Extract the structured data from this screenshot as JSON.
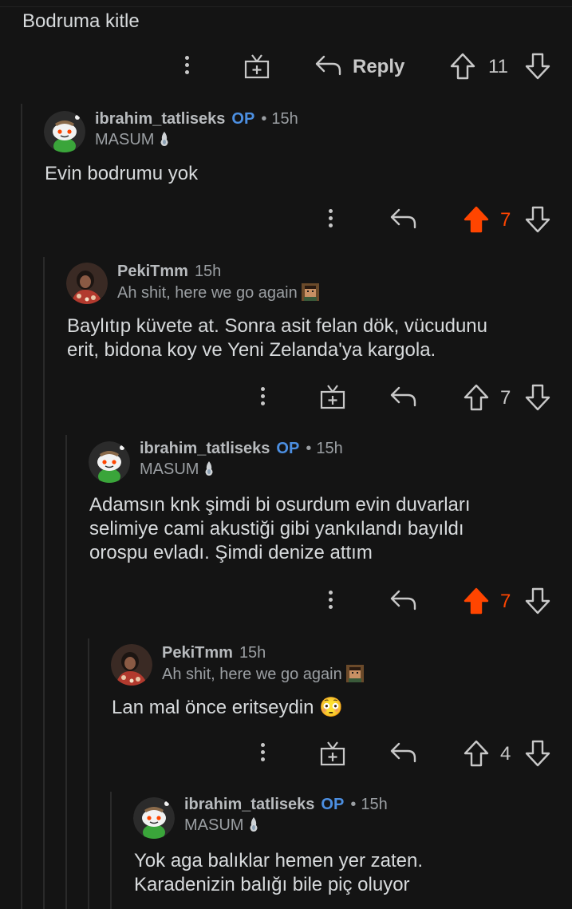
{
  "top_comment": {
    "text": "Bodruma kitle",
    "reply_label": "Reply",
    "votes": "11"
  },
  "comments": [
    {
      "username": "ibrahim_tatliseks",
      "op_badge": "OP",
      "separator": "•",
      "time": "15h",
      "flair": "MASUM",
      "text": "Evin bodrumu yok",
      "votes": "7",
      "upvoted": true
    },
    {
      "username": "PekiTmm",
      "time": "15h",
      "flair": "Ah shit, here we go again",
      "text": "Baylıtıp küvete at. Sonra asit felan dök, vücudunu\nerit, bidona koy ve Yeni Zelanda'ya kargola.",
      "votes": "7",
      "upvoted": false
    },
    {
      "username": "ibrahim_tatliseks",
      "op_badge": "OP",
      "separator": "•",
      "time": "15h",
      "flair": "MASUM",
      "text": "Adamsın knk şimdi bi osurdum evin duvarları\nselimiye cami akustiği gibi yankılandı bayıldı\norospu evladı. Şimdi denize attım",
      "votes": "7",
      "upvoted": true
    },
    {
      "username": "PekiTmm",
      "time": "15h",
      "flair": "Ah shit, here we go again",
      "text": "Lan mal önce eritseydin 😳",
      "votes": "4",
      "upvoted": false
    },
    {
      "username": "ibrahim_tatliseks",
      "op_badge": "OP",
      "separator": "•",
      "time": "15h",
      "flair": "MASUM",
      "text": "Yok aga balıklar hemen yer zaten.\nKaradenizin balığı bile piç oluyor"
    }
  ],
  "icons": {
    "more": "more-vertical-icon",
    "award": "gift-award-icon",
    "reply": "reply-arrow-icon",
    "upvote": "upvote-arrow-icon",
    "downvote": "downvote-arrow-icon",
    "flair_masum": "flame-emoji-icon",
    "flair_peki": "pixel-face-icon"
  },
  "colors": {
    "background": "#141414",
    "text": "#d7dadc",
    "op_blue": "#4c8fe1",
    "upvote_orange": "#ff4500",
    "thread_line": "#2a2a2a"
  }
}
